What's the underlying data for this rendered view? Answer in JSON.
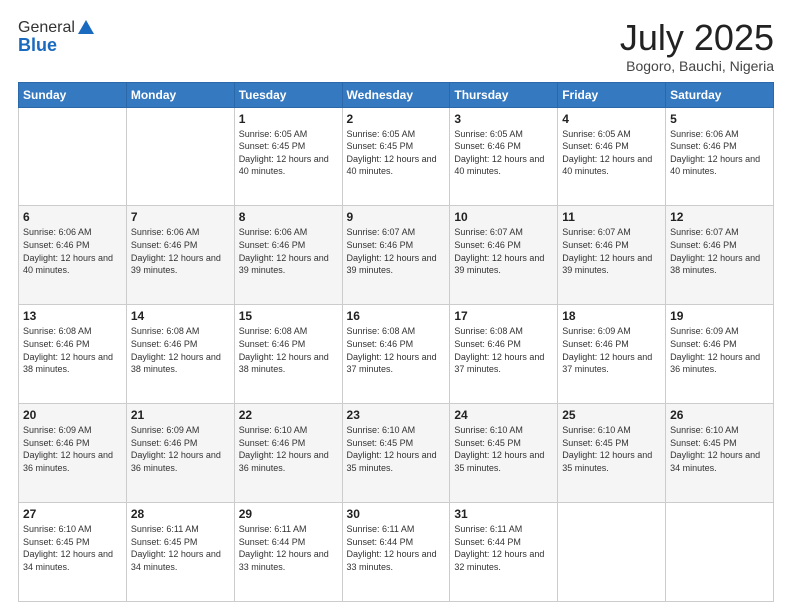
{
  "logo": {
    "general": "General",
    "blue": "Blue"
  },
  "header": {
    "month": "July 2025",
    "location": "Bogoro, Bauchi, Nigeria"
  },
  "days_of_week": [
    "Sunday",
    "Monday",
    "Tuesday",
    "Wednesday",
    "Thursday",
    "Friday",
    "Saturday"
  ],
  "weeks": [
    [
      {
        "day": "",
        "sunrise": "",
        "sunset": "",
        "daylight": ""
      },
      {
        "day": "",
        "sunrise": "",
        "sunset": "",
        "daylight": ""
      },
      {
        "day": "1",
        "sunrise": "Sunrise: 6:05 AM",
        "sunset": "Sunset: 6:45 PM",
        "daylight": "Daylight: 12 hours and 40 minutes."
      },
      {
        "day": "2",
        "sunrise": "Sunrise: 6:05 AM",
        "sunset": "Sunset: 6:45 PM",
        "daylight": "Daylight: 12 hours and 40 minutes."
      },
      {
        "day": "3",
        "sunrise": "Sunrise: 6:05 AM",
        "sunset": "Sunset: 6:46 PM",
        "daylight": "Daylight: 12 hours and 40 minutes."
      },
      {
        "day": "4",
        "sunrise": "Sunrise: 6:05 AM",
        "sunset": "Sunset: 6:46 PM",
        "daylight": "Daylight: 12 hours and 40 minutes."
      },
      {
        "day": "5",
        "sunrise": "Sunrise: 6:06 AM",
        "sunset": "Sunset: 6:46 PM",
        "daylight": "Daylight: 12 hours and 40 minutes."
      }
    ],
    [
      {
        "day": "6",
        "sunrise": "Sunrise: 6:06 AM",
        "sunset": "Sunset: 6:46 PM",
        "daylight": "Daylight: 12 hours and 40 minutes."
      },
      {
        "day": "7",
        "sunrise": "Sunrise: 6:06 AM",
        "sunset": "Sunset: 6:46 PM",
        "daylight": "Daylight: 12 hours and 39 minutes."
      },
      {
        "day": "8",
        "sunrise": "Sunrise: 6:06 AM",
        "sunset": "Sunset: 6:46 PM",
        "daylight": "Daylight: 12 hours and 39 minutes."
      },
      {
        "day": "9",
        "sunrise": "Sunrise: 6:07 AM",
        "sunset": "Sunset: 6:46 PM",
        "daylight": "Daylight: 12 hours and 39 minutes."
      },
      {
        "day": "10",
        "sunrise": "Sunrise: 6:07 AM",
        "sunset": "Sunset: 6:46 PM",
        "daylight": "Daylight: 12 hours and 39 minutes."
      },
      {
        "day": "11",
        "sunrise": "Sunrise: 6:07 AM",
        "sunset": "Sunset: 6:46 PM",
        "daylight": "Daylight: 12 hours and 39 minutes."
      },
      {
        "day": "12",
        "sunrise": "Sunrise: 6:07 AM",
        "sunset": "Sunset: 6:46 PM",
        "daylight": "Daylight: 12 hours and 38 minutes."
      }
    ],
    [
      {
        "day": "13",
        "sunrise": "Sunrise: 6:08 AM",
        "sunset": "Sunset: 6:46 PM",
        "daylight": "Daylight: 12 hours and 38 minutes."
      },
      {
        "day": "14",
        "sunrise": "Sunrise: 6:08 AM",
        "sunset": "Sunset: 6:46 PM",
        "daylight": "Daylight: 12 hours and 38 minutes."
      },
      {
        "day": "15",
        "sunrise": "Sunrise: 6:08 AM",
        "sunset": "Sunset: 6:46 PM",
        "daylight": "Daylight: 12 hours and 38 minutes."
      },
      {
        "day": "16",
        "sunrise": "Sunrise: 6:08 AM",
        "sunset": "Sunset: 6:46 PM",
        "daylight": "Daylight: 12 hours and 37 minutes."
      },
      {
        "day": "17",
        "sunrise": "Sunrise: 6:08 AM",
        "sunset": "Sunset: 6:46 PM",
        "daylight": "Daylight: 12 hours and 37 minutes."
      },
      {
        "day": "18",
        "sunrise": "Sunrise: 6:09 AM",
        "sunset": "Sunset: 6:46 PM",
        "daylight": "Daylight: 12 hours and 37 minutes."
      },
      {
        "day": "19",
        "sunrise": "Sunrise: 6:09 AM",
        "sunset": "Sunset: 6:46 PM",
        "daylight": "Daylight: 12 hours and 36 minutes."
      }
    ],
    [
      {
        "day": "20",
        "sunrise": "Sunrise: 6:09 AM",
        "sunset": "Sunset: 6:46 PM",
        "daylight": "Daylight: 12 hours and 36 minutes."
      },
      {
        "day": "21",
        "sunrise": "Sunrise: 6:09 AM",
        "sunset": "Sunset: 6:46 PM",
        "daylight": "Daylight: 12 hours and 36 minutes."
      },
      {
        "day": "22",
        "sunrise": "Sunrise: 6:10 AM",
        "sunset": "Sunset: 6:46 PM",
        "daylight": "Daylight: 12 hours and 36 minutes."
      },
      {
        "day": "23",
        "sunrise": "Sunrise: 6:10 AM",
        "sunset": "Sunset: 6:45 PM",
        "daylight": "Daylight: 12 hours and 35 minutes."
      },
      {
        "day": "24",
        "sunrise": "Sunrise: 6:10 AM",
        "sunset": "Sunset: 6:45 PM",
        "daylight": "Daylight: 12 hours and 35 minutes."
      },
      {
        "day": "25",
        "sunrise": "Sunrise: 6:10 AM",
        "sunset": "Sunset: 6:45 PM",
        "daylight": "Daylight: 12 hours and 35 minutes."
      },
      {
        "day": "26",
        "sunrise": "Sunrise: 6:10 AM",
        "sunset": "Sunset: 6:45 PM",
        "daylight": "Daylight: 12 hours and 34 minutes."
      }
    ],
    [
      {
        "day": "27",
        "sunrise": "Sunrise: 6:10 AM",
        "sunset": "Sunset: 6:45 PM",
        "daylight": "Daylight: 12 hours and 34 minutes."
      },
      {
        "day": "28",
        "sunrise": "Sunrise: 6:11 AM",
        "sunset": "Sunset: 6:45 PM",
        "daylight": "Daylight: 12 hours and 34 minutes."
      },
      {
        "day": "29",
        "sunrise": "Sunrise: 6:11 AM",
        "sunset": "Sunset: 6:44 PM",
        "daylight": "Daylight: 12 hours and 33 minutes."
      },
      {
        "day": "30",
        "sunrise": "Sunrise: 6:11 AM",
        "sunset": "Sunset: 6:44 PM",
        "daylight": "Daylight: 12 hours and 33 minutes."
      },
      {
        "day": "31",
        "sunrise": "Sunrise: 6:11 AM",
        "sunset": "Sunset: 6:44 PM",
        "daylight": "Daylight: 12 hours and 32 minutes."
      },
      {
        "day": "",
        "sunrise": "",
        "sunset": "",
        "daylight": ""
      },
      {
        "day": "",
        "sunrise": "",
        "sunset": "",
        "daylight": ""
      }
    ]
  ]
}
